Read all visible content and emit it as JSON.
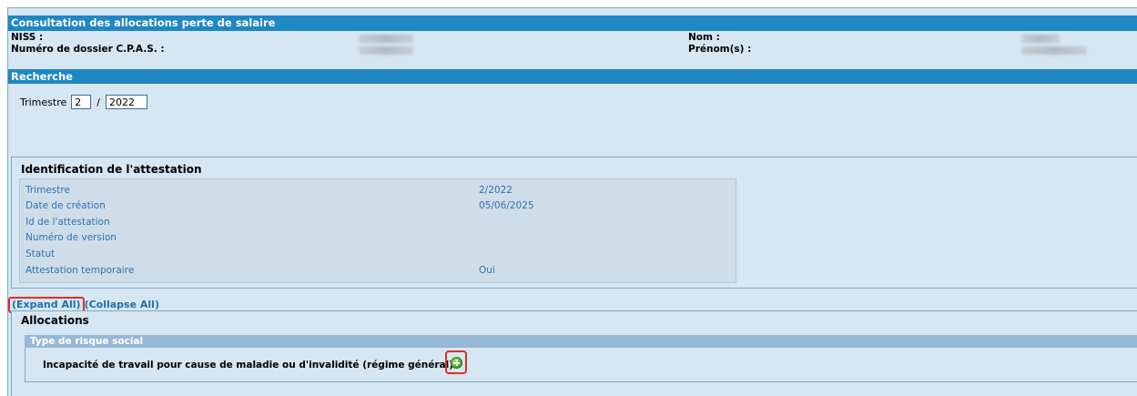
{
  "header": {
    "title": "Consultation des allocations perte de salaire"
  },
  "person": {
    "niss_label": "NISS :",
    "dossier_label": "Numéro de dossier C.P.A.S. :",
    "nom_label": "Nom :",
    "prenom_label": "Prénom(s) :"
  },
  "search": {
    "section_title": "Recherche",
    "trimestre_label": "Trimestre",
    "trimestre_value": "2",
    "separator": "/",
    "year_value": "2022"
  },
  "ident": {
    "title": "Identification de l'attestation",
    "rows": [
      {
        "label": "Trimestre",
        "value": "2/2022"
      },
      {
        "label": "Date de création",
        "value": "05/06/2025"
      },
      {
        "label": "Id de l'attestation",
        "value": ""
      },
      {
        "label": "Numéro de version",
        "value": ""
      },
      {
        "label": "Statut",
        "value": ""
      },
      {
        "label": "Attestation temporaire",
        "value": "Oui"
      }
    ]
  },
  "links": {
    "expand": "(Expand All)",
    "collapse": "(Collapse All)"
  },
  "alloc": {
    "title": "Allocations",
    "column_header": "Type de risque social",
    "items": [
      {
        "label": "Incapacité de travail pour cause de maladie ou d'invalidité (régime général)"
      }
    ]
  },
  "icons": {
    "expand_item": "plus-circle-icon"
  },
  "colors": {
    "bar": "#1f87c4",
    "panel": "#d6e6f2",
    "link": "#1f6fb0",
    "highlight": "#e0301e"
  }
}
